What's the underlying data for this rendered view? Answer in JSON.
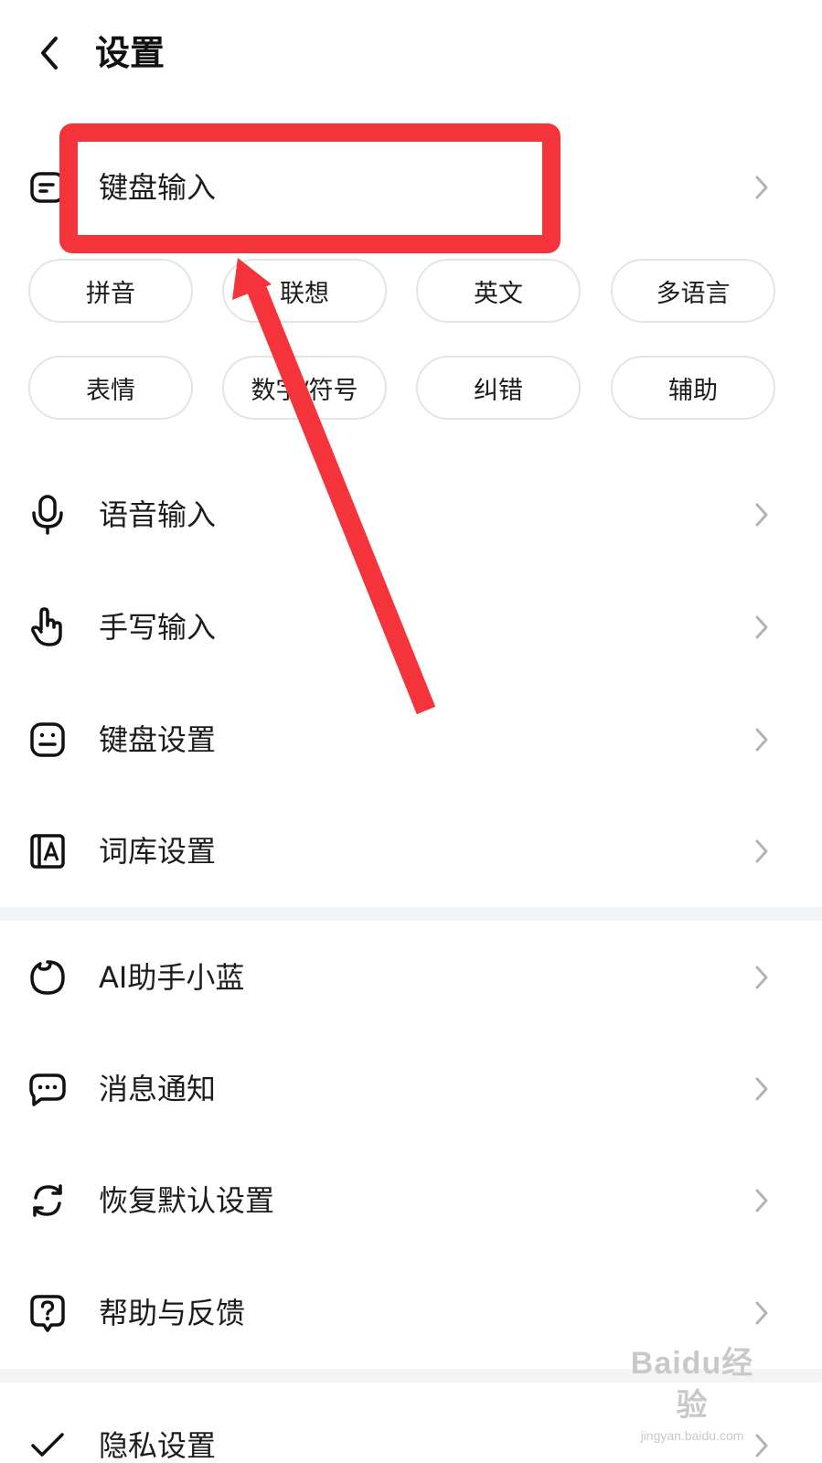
{
  "header": {
    "title": "设置"
  },
  "keyboard_input": {
    "label": "键盘输入",
    "chips": [
      "拼音",
      "联想",
      "英文",
      "多语言",
      "表情",
      "数字/符号",
      "纠错",
      "辅助"
    ]
  },
  "menu": [
    {
      "label": "语音输入",
      "icon": "microphone-icon"
    },
    {
      "label": "手写输入",
      "icon": "hand-pointer-icon"
    },
    {
      "label": "键盘设置",
      "icon": "keyboard-icon"
    },
    {
      "label": "词库设置",
      "icon": "dictionary-icon"
    }
  ],
  "menu2": [
    {
      "label": "AI助手小蓝",
      "icon": "ai-assistant-icon"
    },
    {
      "label": "消息通知",
      "icon": "message-icon"
    },
    {
      "label": "恢复默认设置",
      "icon": "refresh-icon"
    },
    {
      "label": "帮助与反馈",
      "icon": "help-icon"
    }
  ],
  "partial_row": {
    "label": "隐私设置",
    "icon": "check-icon"
  },
  "annotation": {
    "color": "#f5333a"
  },
  "watermark": {
    "logo": "Baidu经验",
    "url": "jingyan.baidu.com"
  }
}
